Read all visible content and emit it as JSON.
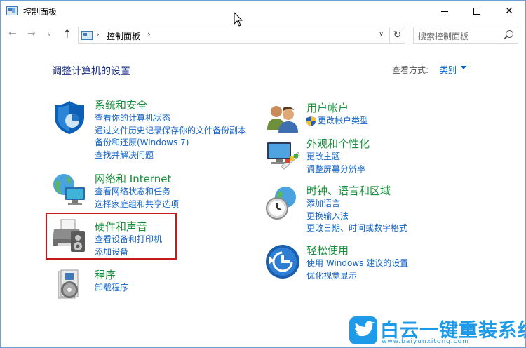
{
  "window": {
    "title": "控制面板",
    "controls": {
      "minimize": "minimize",
      "maximize": "maximize",
      "close": "✕"
    }
  },
  "nav": {
    "back": "←",
    "forward": "→",
    "recent": "∨",
    "up": "↑",
    "breadcrumb_sep": "›",
    "address": "控制面板",
    "dropdown": "∨",
    "refresh": "↻",
    "search_placeholder": "搜索控制面板"
  },
  "main": {
    "title": "调整计算机的设置",
    "view_label": "查看方式:",
    "view_value": "类别"
  },
  "categories_left": [
    {
      "title": "系统和安全",
      "icon": "shield-icon",
      "links": [
        "查看你的计算机状态",
        "通过文件历史记录保存你的文件备份副本",
        "备份和还原(Windows 7)",
        "查找并解决问题"
      ]
    },
    {
      "title": "网络和 Internet",
      "icon": "network-globe-icon",
      "links": [
        "查看网络状态和任务",
        "选择家庭组和共享选项"
      ]
    },
    {
      "title": "硬件和声音",
      "icon": "printer-speaker-icon",
      "links": [
        "查看设备和打印机",
        "添加设备"
      ]
    },
    {
      "title": "程序",
      "icon": "programs-disc-icon",
      "links": [
        "卸载程序"
      ]
    }
  ],
  "categories_right": [
    {
      "title": "用户帐户",
      "icon": "users-icon",
      "links": [
        "更改帐户类型"
      ]
    },
    {
      "title": "外观和个性化",
      "icon": "monitor-palette-icon",
      "links": [
        "更改主题",
        "调整屏幕分辨率"
      ]
    },
    {
      "title": "时钟、语言和区域",
      "icon": "clock-globe-icon",
      "links": [
        "添加语言",
        "更换输入法",
        "更改日期、时间或数字格式"
      ]
    },
    {
      "title": "轻松使用",
      "icon": "ease-of-access-icon",
      "links": [
        "使用 Windows 建议的设置",
        "优化视觉显示"
      ]
    }
  ],
  "watermark": {
    "text": "白云一键重装系统",
    "url": "www.baiyunxitong.com"
  },
  "colors": {
    "category_title": "#1a8f3c",
    "link": "#1464c8",
    "page_title": "#1e3287",
    "highlight": "#c41a1a",
    "watermark": "#1e9be8"
  }
}
